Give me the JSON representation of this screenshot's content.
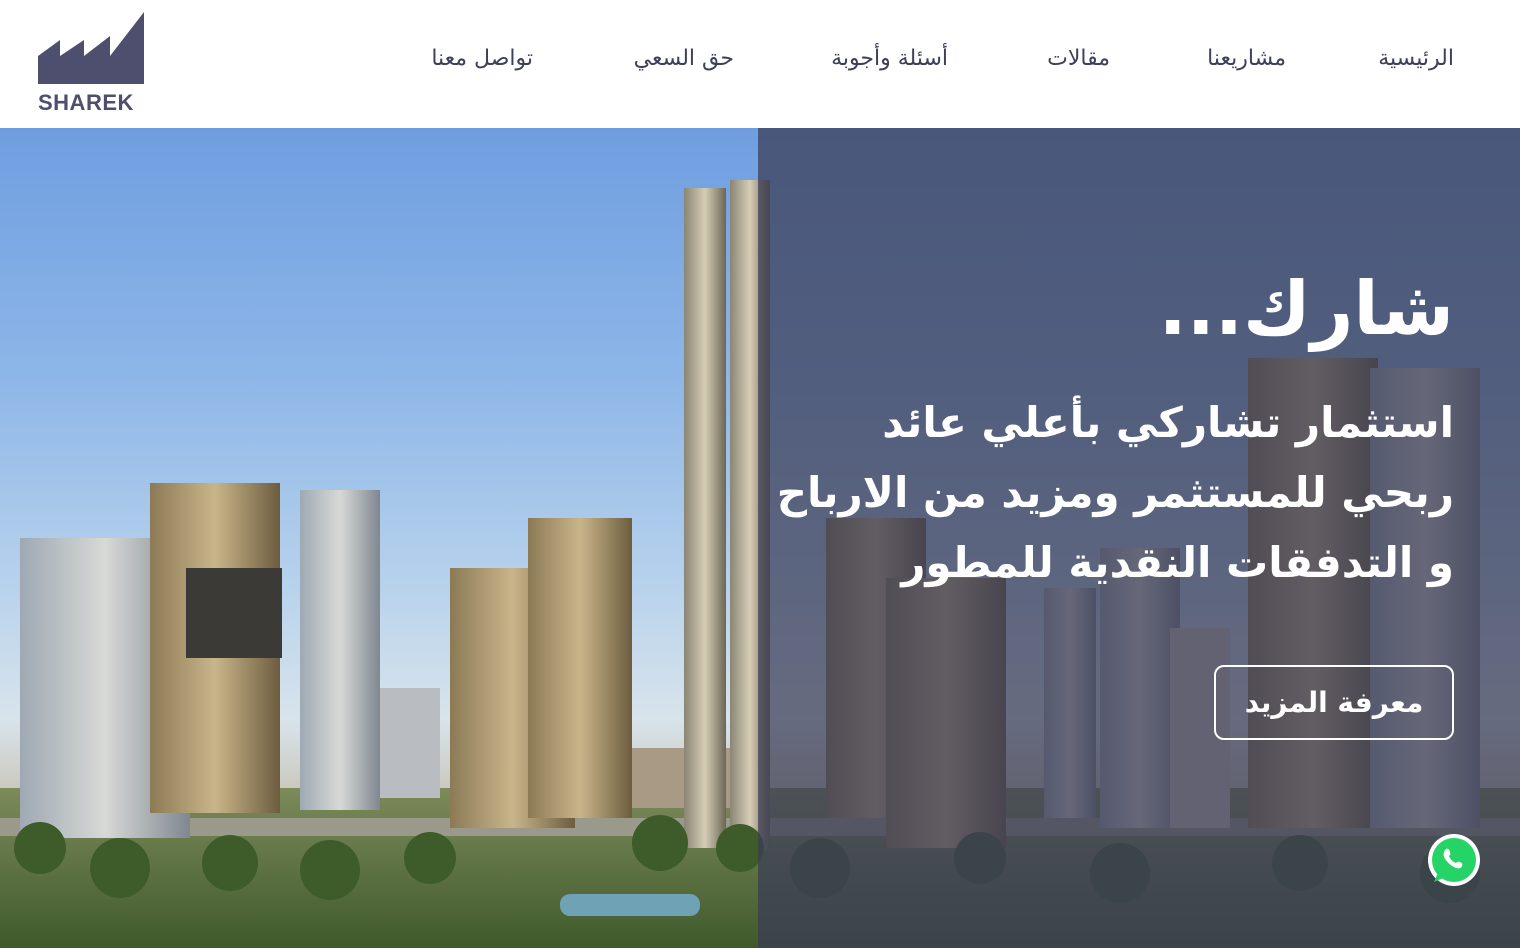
{
  "brand": {
    "name": "SHAREK",
    "color": "#4e4f6e",
    "logo_icon": "factory-roof-logo-icon"
  },
  "nav": {
    "items": [
      {
        "label": "الرئيسية"
      },
      {
        "label": "مشاريعنا"
      },
      {
        "label": "مقالات"
      },
      {
        "label": "أسئلة وأجوبة"
      },
      {
        "label": "حق السعي"
      },
      {
        "label": "تواصل معنا"
      }
    ]
  },
  "hero": {
    "title": "شارك...",
    "subtitle": "استثمار تشاركي بأعلي عائد ربحي للمستثمر ومزيد من الارباح و التدفقات النقدية للمطور",
    "cta_label": "معرفة المزيد",
    "overlay_color": "#3a3c54"
  },
  "floating": {
    "whatsapp_icon": "whatsapp-icon",
    "whatsapp_color": "#25d366"
  }
}
